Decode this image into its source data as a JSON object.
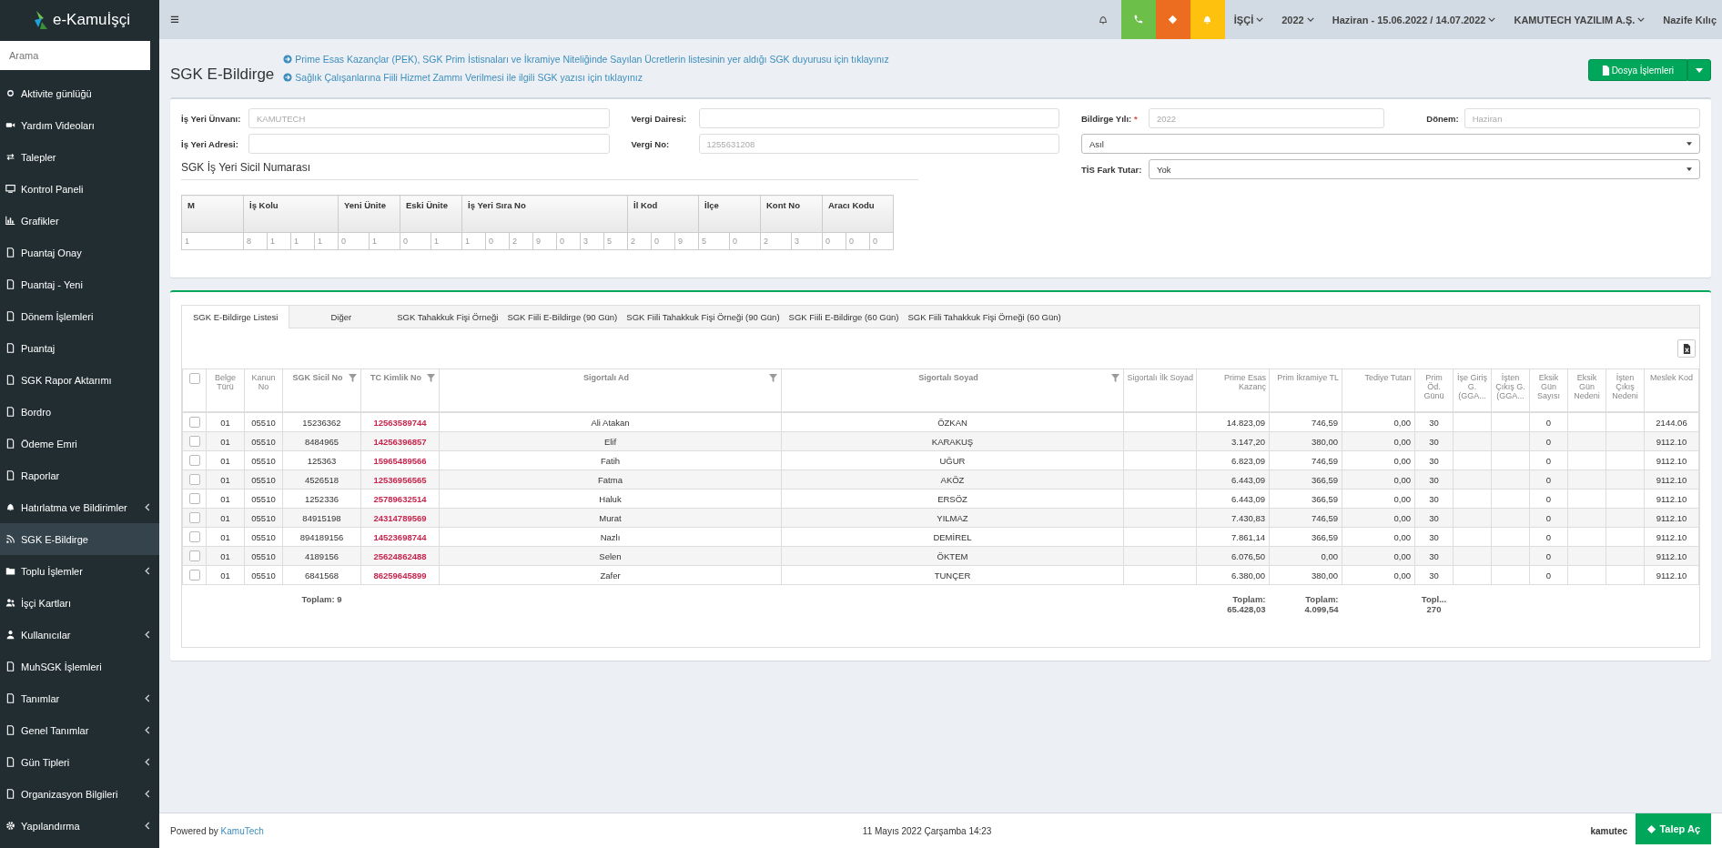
{
  "brand": {
    "logo_text": "e-Kamuİşçi"
  },
  "sidebar": {
    "search": {
      "placeholder": "Arama"
    },
    "items": [
      {
        "label": "Aktivite günlüğü",
        "selected": false,
        "submenu": false
      },
      {
        "label": "Yardım Videoları",
        "selected": false,
        "submenu": false
      },
      {
        "label": "Talepler",
        "selected": false,
        "submenu": false
      },
      {
        "label": "Kontrol Paneli",
        "selected": false,
        "submenu": false
      },
      {
        "label": "Grafikler",
        "selected": false,
        "submenu": false
      },
      {
        "label": "Puantaj Onay",
        "selected": false,
        "submenu": false
      },
      {
        "label": "Puantaj - Yeni",
        "selected": false,
        "submenu": false
      },
      {
        "label": "Dönem İşlemleri",
        "selected": false,
        "submenu": false
      },
      {
        "label": "Puantaj",
        "selected": false,
        "submenu": false
      },
      {
        "label": "SGK Rapor Aktarımı",
        "selected": false,
        "submenu": false
      },
      {
        "label": "Bordro",
        "selected": false,
        "submenu": false
      },
      {
        "label": "Ödeme Emri",
        "selected": false,
        "submenu": false
      },
      {
        "label": "Raporlar",
        "selected": false,
        "submenu": false
      },
      {
        "label": "Hatırlatma ve Bildirimler",
        "selected": false,
        "submenu": true
      },
      {
        "label": "SGK E-Bildirge",
        "selected": true,
        "submenu": false
      },
      {
        "label": "Toplu İşlemler",
        "selected": false,
        "submenu": true
      },
      {
        "label": "İşçi Kartları",
        "selected": false,
        "submenu": false
      },
      {
        "label": "Kullanıcılar",
        "selected": false,
        "submenu": true
      },
      {
        "label": "MuhSGK İşlemleri",
        "selected": false,
        "submenu": false
      },
      {
        "label": "Tanımlar",
        "selected": false,
        "submenu": true
      },
      {
        "label": "Genel Tanımlar",
        "selected": false,
        "submenu": true
      },
      {
        "label": "Gün Tipleri",
        "selected": false,
        "submenu": true
      },
      {
        "label": "Organizasyon Bilgileri",
        "selected": false,
        "submenu": true
      },
      {
        "label": "Yapılandırma",
        "selected": false,
        "submenu": true
      }
    ]
  },
  "topbar": {
    "menu_glyph": "≡",
    "dropdowns": [
      "İŞÇİ",
      "2022",
      "Haziran - 15.06.2022 / 14.07.2022",
      "KAMUTECH YAZILIM A.Ş."
    ],
    "user": "Nazife Kılıç"
  },
  "page": {
    "title": "SGK E-Bildirge",
    "links": [
      "Prime Esas Kazançlar (PEK), SGK Prim İstisnaları ve İkramiye Niteliğinde Sayılan Ücretlerin listesinin yer aldığı SGK duyurusu için tıklayınız",
      "Sağlık Çalışanlarına Fiili Hizmet Zammı Verilmesi ile ilgili SGK yazısı için tıklayınız"
    ],
    "file_button": "Dosya İşlemleri"
  },
  "form": {
    "fields": [
      {
        "label": "İş Yeri Ünvanı:",
        "placeholder": "KAMUTECH"
      },
      {
        "label": "Vergi Dairesi:"
      },
      {
        "label": "İş Yeri Adresi:"
      },
      {
        "label": "Vergi No:",
        "placeholder": "1255631208"
      }
    ],
    "year": {
      "label": "Bildirge Yılı:",
      "required_mark": "*",
      "placeholder": "2022"
    },
    "period": {
      "label": "Dönem:",
      "placeholder": "Haziran"
    },
    "type_select": {
      "value": "Asıl"
    },
    "tis": {
      "label": "TİS Fark Tutar:",
      "value": "Yok"
    },
    "sicil_title": "SGK İş Yeri Sicil Numarası",
    "sicil": [
      {
        "label": "M",
        "digits": [
          "1"
        ]
      },
      {
        "label": "İş Kolu",
        "digits": [
          "8",
          "1",
          "1",
          "1"
        ]
      },
      {
        "label": "Yeni Ünite",
        "digits": [
          "0",
          "1"
        ]
      },
      {
        "label": "Eski Ünite",
        "digits": [
          "0",
          "1"
        ]
      },
      {
        "label": "İş Yeri Sıra No",
        "digits": [
          "1",
          "0",
          "2",
          "9",
          "0",
          "3",
          "5"
        ]
      },
      {
        "label": "İl Kod",
        "digits": [
          "2",
          "0",
          "9"
        ]
      },
      {
        "label": "İlçe",
        "digits": [
          "5",
          "0"
        ]
      },
      {
        "label": "Kont No",
        "digits": [
          "2",
          "3"
        ]
      },
      {
        "label": "Aracı Kodu",
        "digits": [
          "0",
          "0",
          "0"
        ]
      }
    ]
  },
  "tabs": [
    {
      "label": "SGK E-Bildirge Listesi",
      "selected": true
    },
    {
      "label": "Diğer",
      "selected": false
    },
    {
      "label": "SGK Tahakkuk Fişi Örneği",
      "selected": false
    },
    {
      "label": "SGK Fiili E-Bildirge (90 Gün)",
      "selected": false
    },
    {
      "label": "SGK Fiili Tahakkuk Fişi Örneği (90 Gün)",
      "selected": false
    },
    {
      "label": "SGK Fiili E-Bildirge (60 Gün)",
      "selected": false
    },
    {
      "label": "SGK Fiili Tahakkuk Fişi Örneği (60 Gün)",
      "selected": false
    }
  ],
  "table": {
    "select_all": {
      "checked": false
    },
    "columns": [
      {
        "label": "Belge Türü",
        "filter": false,
        "bold": false
      },
      {
        "label": "Kanun No",
        "filter": false,
        "bold": false
      },
      {
        "label": "SGK Sicil No",
        "filter": true,
        "bold": true
      },
      {
        "label": "TC Kimlik No",
        "filter": true,
        "bold": true
      },
      {
        "label": "Sigortalı Ad",
        "filter": true,
        "bold": true
      },
      {
        "label": "Sigortalı Soyad",
        "filter": true,
        "bold": true
      },
      {
        "label": "Sigortalı İlk Soyad",
        "filter": false,
        "bold": false
      },
      {
        "label": "Prime Esas Kazanç",
        "filter": false,
        "bold": false
      },
      {
        "label": "Prim İkramiye TL",
        "filter": false,
        "bold": false
      },
      {
        "label": "Tediye Tutarı",
        "filter": false,
        "bold": false
      },
      {
        "label": "Prim Öd. Günü",
        "filter": false,
        "bold": false
      },
      {
        "label": "İşe Giriş G. (GGA...",
        "filter": false,
        "bold": false
      },
      {
        "label": "İşten Çıkış G. (GGA...",
        "filter": false,
        "bold": false
      },
      {
        "label": "Eksik Gün Sayısı",
        "filter": false,
        "bold": false
      },
      {
        "label": "Eksik Gün Nedeni",
        "filter": false,
        "bold": false
      },
      {
        "label": "İşten Çıkış Nedeni",
        "filter": false,
        "bold": false
      },
      {
        "label": "Meslek Kod",
        "filter": false,
        "bold": false
      }
    ],
    "rows": [
      {
        "checked": false,
        "cells": [
          "01",
          "05510",
          "15236362",
          "12563589744",
          "Ali Atakan",
          "ÖZKAN",
          "",
          "14.823,09",
          "746,59",
          "0,00",
          "30",
          "",
          "",
          "0",
          "",
          "",
          "2144.06"
        ]
      },
      {
        "checked": false,
        "cells": [
          "01",
          "05510",
          "8484965",
          "14256396857",
          "Elif",
          "KARAKUŞ",
          "",
          "3.147,20",
          "380,00",
          "0,00",
          "30",
          "",
          "",
          "0",
          "",
          "",
          "9112.10"
        ]
      },
      {
        "checked": false,
        "cells": [
          "01",
          "05510",
          "125363",
          "15965489566",
          "Fatih",
          "UĞUR",
          "",
          "6.823,09",
          "746,59",
          "0,00",
          "30",
          "",
          "",
          "0",
          "",
          "",
          "9112.10"
        ]
      },
      {
        "checked": false,
        "cells": [
          "01",
          "05510",
          "4526518",
          "12536956565",
          "Fatma",
          "AKÖZ",
          "",
          "6.443,09",
          "366,59",
          "0,00",
          "30",
          "",
          "",
          "0",
          "",
          "",
          "9112.10"
        ]
      },
      {
        "checked": false,
        "cells": [
          "01",
          "05510",
          "1252336",
          "25789632514",
          "Haluk",
          "ERSÖZ",
          "",
          "6.443,09",
          "366,59",
          "0,00",
          "30",
          "",
          "",
          "0",
          "",
          "",
          "9112.10"
        ]
      },
      {
        "checked": false,
        "cells": [
          "01",
          "05510",
          "84915198",
          "24314789569",
          "Murat",
          "YILMAZ",
          "",
          "7.430,83",
          "746,59",
          "0,00",
          "30",
          "",
          "",
          "0",
          "",
          "",
          "9112.10"
        ]
      },
      {
        "checked": false,
        "cells": [
          "01",
          "05510",
          "894189156",
          "14523698744",
          "Nazlı",
          "DEMİREL",
          "",
          "7.861,14",
          "366,59",
          "0,00",
          "30",
          "",
          "",
          "0",
          "",
          "",
          "9112.10"
        ]
      },
      {
        "checked": false,
        "cells": [
          "01",
          "05510",
          "4189156",
          "25624862488",
          "Selen",
          "ÖKTEM",
          "",
          "6.076,50",
          "0,00",
          "0,00",
          "30",
          "",
          "",
          "0",
          "",
          "",
          "9112.10"
        ]
      },
      {
        "checked": false,
        "cells": [
          "01",
          "05510",
          "6841568",
          "86259645899",
          "Zafer",
          "TUNÇER",
          "",
          "6.380,00",
          "380,00",
          "0,00",
          "30",
          "",
          "",
          "0",
          "",
          "",
          "9112.10"
        ]
      }
    ],
    "totals": {
      "record_count": {
        "label": "Toplam:",
        "value": "9"
      },
      "prime_esas_kazanc": {
        "label": "Toplam:",
        "value": "65.428,03"
      },
      "prim_ikramiye": {
        "label": "Toplam:",
        "value": "4.099,54"
      },
      "prim_gunu": {
        "label": "Topl...",
        "value": "270"
      }
    }
  },
  "footer": {
    "powered_by": "Powered by",
    "powered_link": "KamuTech",
    "datetime": "11 Mayıs 2022 Çarşamba 14:23",
    "right_text": "kamutec"
  },
  "request_button": "Talep Aç"
}
